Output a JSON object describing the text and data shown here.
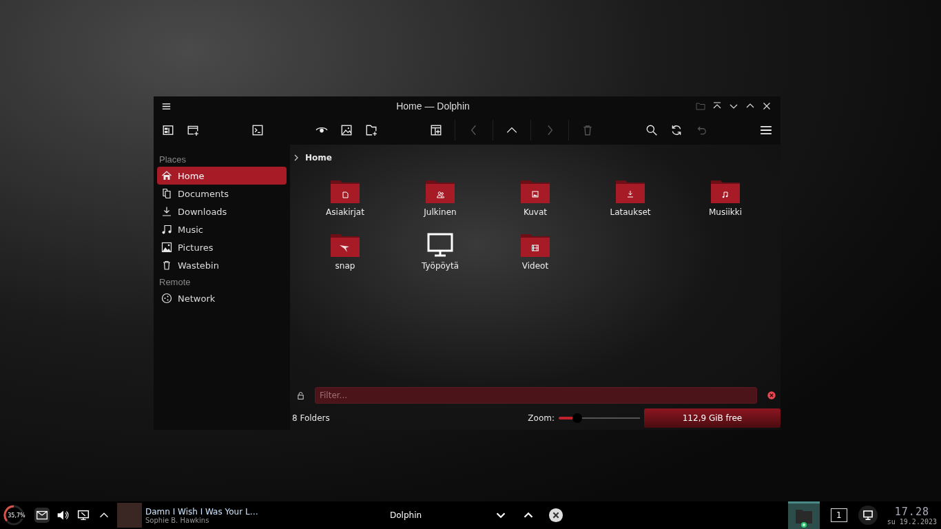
{
  "window": {
    "title": "Home — Dolphin"
  },
  "toolbar": [
    [
      {
        "kind": "panel",
        "disabled": false
      },
      {
        "kind": "new-tab",
        "disabled": false
      }
    ],
    [
      {
        "kind": "terminal",
        "disabled": false
      }
    ],
    [
      {
        "kind": "preview",
        "disabled": false
      },
      {
        "kind": "image",
        "disabled": false
      },
      {
        "kind": "new-file",
        "disabled": false
      }
    ],
    [
      {
        "kind": "split",
        "disabled": false
      },
      {
        "kind": "back",
        "disabled": true
      },
      {
        "kind": "up",
        "disabled": false
      },
      {
        "kind": "forward",
        "disabled": true
      },
      {
        "kind": "trash",
        "disabled": true
      }
    ],
    [
      {
        "kind": "search",
        "disabled": false
      },
      {
        "kind": "reload",
        "disabled": false
      },
      {
        "kind": "undo",
        "disabled": true
      }
    ],
    [
      {
        "kind": "menu",
        "disabled": false
      }
    ]
  ],
  "sidebar": {
    "sections": [
      {
        "title": "Places",
        "items": [
          {
            "label": "Home",
            "kind": "home",
            "selected": true
          },
          {
            "label": "Documents",
            "kind": "document",
            "selected": false
          },
          {
            "label": "Downloads",
            "kind": "download",
            "selected": false
          },
          {
            "label": "Music",
            "kind": "music",
            "selected": false
          },
          {
            "label": "Pictures",
            "kind": "picture",
            "selected": false
          },
          {
            "label": "Wastebin",
            "kind": "trash",
            "selected": false
          }
        ]
      },
      {
        "title": "Remote",
        "items": [
          {
            "label": "Network",
            "kind": "network",
            "selected": false
          }
        ]
      }
    ]
  },
  "breadcrumb": "Home",
  "files": [
    {
      "name": "Asiakirjat",
      "kind": "document"
    },
    {
      "name": "Julkinen",
      "kind": "people"
    },
    {
      "name": "Kuvat",
      "kind": "picture"
    },
    {
      "name": "Lataukset",
      "kind": "download"
    },
    {
      "name": "Musiikki",
      "kind": "music"
    },
    {
      "name": "snap",
      "kind": "bird"
    },
    {
      "name": "Työpöytä",
      "kind": "monitor"
    },
    {
      "name": "Videot",
      "kind": "film"
    }
  ],
  "filter": {
    "placeholder": "Filter..."
  },
  "status_bar": {
    "summary": "8 Folders",
    "zoom": {
      "label": "Zoom:",
      "level": 0.23
    },
    "free_space": "112,9 GiB free"
  },
  "taskbar": {
    "meter": {
      "reading": "35,7%",
      "level": 0.357
    },
    "media": {
      "title": "Damn I Wish I Was Your L…",
      "artist": "Sophie B. Hawkins"
    },
    "task": "Dolphin",
    "pager": "1",
    "clock": {
      "time": "17.28",
      "date": "su 19.2.2023"
    }
  }
}
